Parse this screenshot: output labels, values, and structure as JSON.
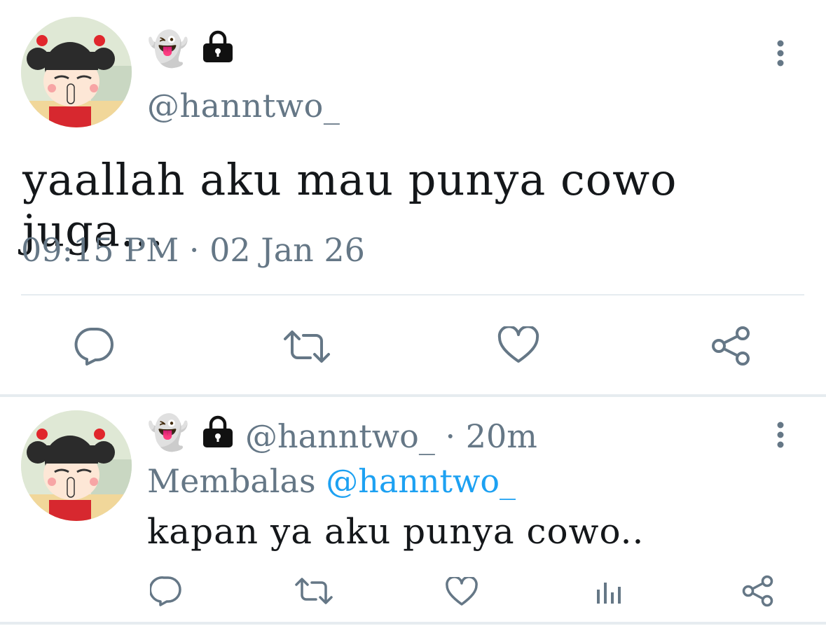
{
  "main_tweet": {
    "name_emoji": "👻",
    "handle": "@hanntwo_",
    "text": "yaallah aku mau punya cowo juga...",
    "timestamp": "09:15 PM · 02 Jan 26"
  },
  "reply_tweet": {
    "name_emoji": "👻",
    "handle": "@hanntwo_",
    "time_sep": " · ",
    "time": "20m",
    "replying_prefix": "Membalas",
    "replying_to": "@hanntwo_",
    "text": "kapan ya aku punya cowo.."
  },
  "colors": {
    "secondary_text": "#657786",
    "link": "#1da1f2",
    "divider": "#e6ecf0",
    "primary_text": "#14171a"
  },
  "icons": [
    "ghost-emoji",
    "lock-icon",
    "more-icon",
    "reply-icon",
    "retweet-icon",
    "like-icon",
    "share-icon",
    "analytics-icon"
  ]
}
